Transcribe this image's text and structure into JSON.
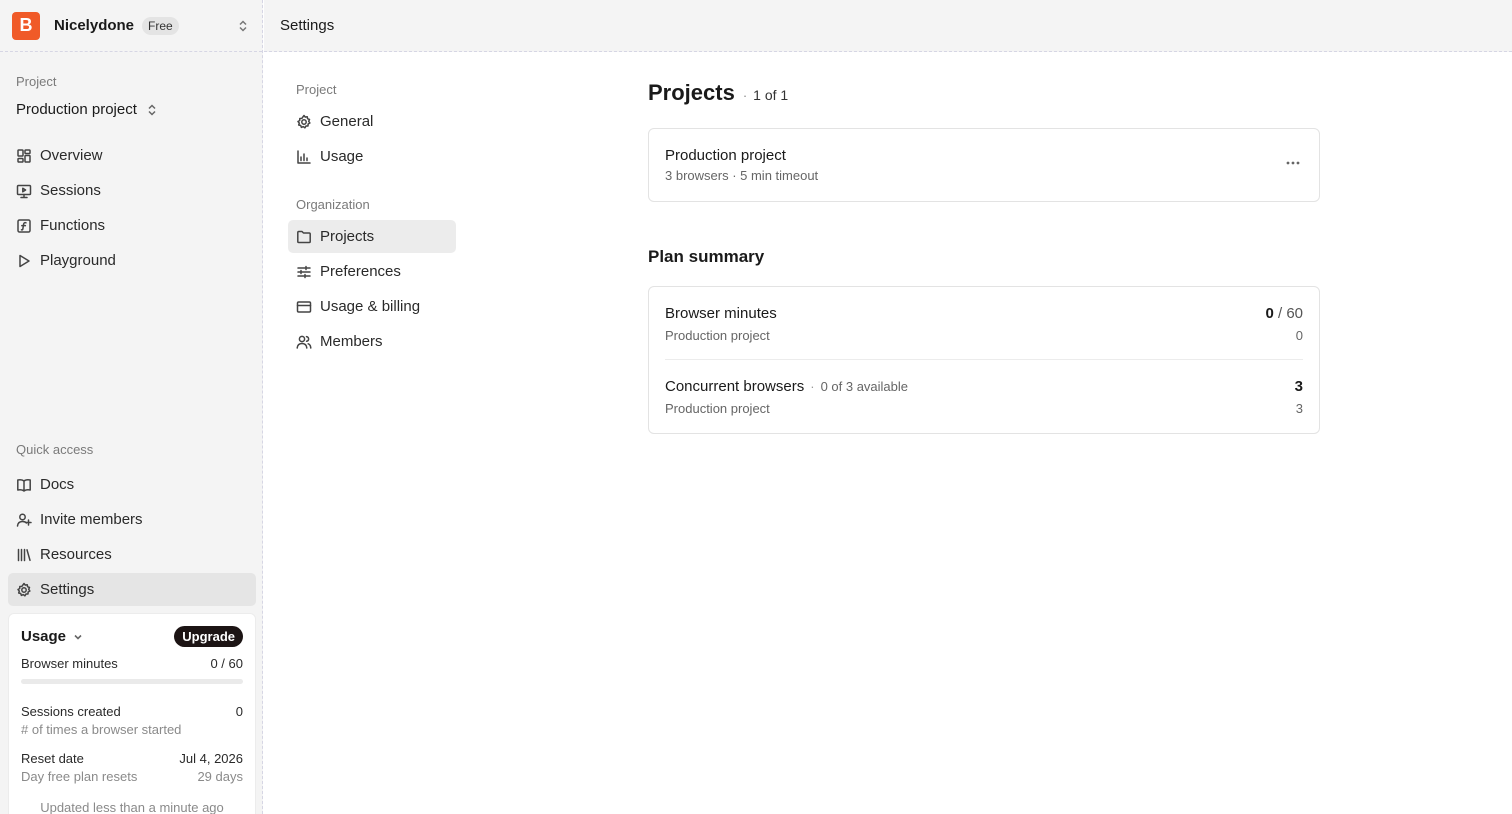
{
  "org": {
    "logo_letter": "B",
    "name": "Nicelydone",
    "plan": "Free"
  },
  "sidebar": {
    "project_label": "Project",
    "project_name": "Production project",
    "nav": [
      {
        "label": "Overview",
        "icon": "overview-icon"
      },
      {
        "label": "Sessions",
        "icon": "sessions-icon"
      },
      {
        "label": "Functions",
        "icon": "functions-icon"
      },
      {
        "label": "Playground",
        "icon": "play-icon"
      }
    ],
    "quick_label": "Quick access",
    "quick": [
      {
        "label": "Docs",
        "icon": "book-icon"
      },
      {
        "label": "Invite members",
        "icon": "user-plus-icon"
      },
      {
        "label": "Resources",
        "icon": "library-icon"
      },
      {
        "label": "Settings",
        "icon": "gear-icon",
        "active": true
      }
    ]
  },
  "usage": {
    "title": "Usage",
    "upgrade": "Upgrade",
    "browser_minutes_label": "Browser minutes",
    "browser_minutes_value": "0 / 60",
    "browser_minutes_fraction": 0,
    "sessions_label": "Sessions created",
    "sessions_value": "0",
    "sessions_sub": "# of times a browser started",
    "reset_label": "Reset date",
    "reset_value": "Jul 4, 2026",
    "reset_sub": "Day free plan resets",
    "reset_days": "29 days",
    "updated": "Updated less than a minute ago"
  },
  "header": {
    "title": "Settings"
  },
  "settings_nav": {
    "project_group": "Project",
    "project_items": [
      {
        "label": "General",
        "icon": "gear-icon"
      },
      {
        "label": "Usage",
        "icon": "bar-chart-icon"
      }
    ],
    "org_group": "Organization",
    "org_items": [
      {
        "label": "Projects",
        "icon": "folder-icon",
        "active": true
      },
      {
        "label": "Preferences",
        "icon": "sliders-icon"
      },
      {
        "label": "Usage & billing",
        "icon": "credit-card-icon"
      },
      {
        "label": "Members",
        "icon": "users-icon"
      }
    ]
  },
  "main": {
    "title": "Projects",
    "count": "1 of 1",
    "project": {
      "name": "Production project",
      "meta": "3 browsers · 5 min timeout"
    },
    "plan_title": "Plan summary",
    "plan_rows": [
      {
        "name": "Browser minutes",
        "note": "",
        "value_main": "0",
        "value_limit": " / 60",
        "sub_label": "Production project",
        "sub_value": "0"
      },
      {
        "name": "Concurrent browsers",
        "note": "0 of 3 available",
        "value_main": "3",
        "value_limit": "",
        "sub_label": "Production project",
        "sub_value": "3"
      }
    ]
  }
}
